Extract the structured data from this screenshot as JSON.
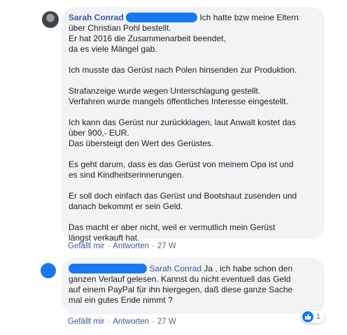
{
  "comments": [
    {
      "author": "Sarah Conrad",
      "paragraphs": [
        "Ich hatte bzw meine Eltern\nüber Christian Pohl bestellt.\nEr hat 2016 die Zusammenarbeit beendet,\nda es viele Mängel gab.",
        "Ich musste das Gerüst nach Polen hinsenden zur Produktion.",
        "Strafanzeige wurde wegen Unterschlagung gestellt.\nVerfahren wurde mangels öffentliches Interesse eingestellt.",
        "Ich kann das Gerüst nur zurückklagen, laut Anwalt kostet das\nüber 900,- EUR.\nDas übersteigt den Wert des Gerüstes.",
        "Es geht darum, dass es das Gerüst von meinem Opa ist und\nes sind Kindheitserinnerungen.",
        "Er soll doch einfach das Gerüst und Bootshaut zusenden und\ndanach bekommt er sein Geld.",
        "Das macht er aber nicht, weil er vermutlich mein Gerüst\nlängst verkauft hat."
      ],
      "actions": {
        "like": "Gefällt mir",
        "reply": "Antworten",
        "time": "27 W"
      }
    },
    {
      "mention": "Sarah Conrad",
      "text": "Ja , ich habe schon den\nganzen Verlauf gelesen. Kannst du nicht eventuell das Geld\nauf einem PayPal für ihn hiergegen, daß diese ganze Sache\nmal ein gutes Ende nimmt ?",
      "actions": {
        "like": "Gefällt mir",
        "reply": "Antworten",
        "time": "27 W"
      },
      "reaction": {
        "icon": "like-icon",
        "count": "1"
      }
    }
  ],
  "colors": {
    "link": "#385898",
    "bubble": "#f2f3f5",
    "redaction": "#1877f2",
    "meta": "#606770"
  }
}
